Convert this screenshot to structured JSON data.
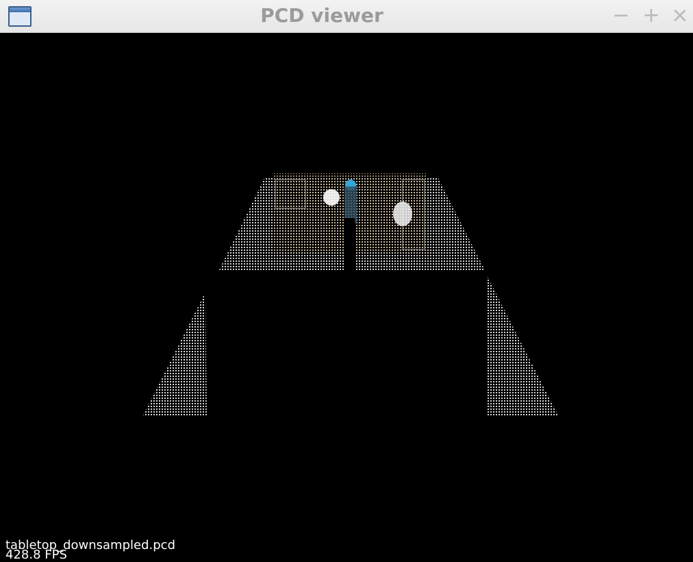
{
  "window": {
    "title": "PCD viewer",
    "icon": "window-app-icon",
    "controls": {
      "minimize": "−",
      "maximize": "+",
      "close": "×"
    }
  },
  "viewer": {
    "background": "#000000",
    "point_color": "#d9d9d9",
    "filename": "tabletop_downsampled.pcd",
    "fps": "428.8 FPS"
  }
}
